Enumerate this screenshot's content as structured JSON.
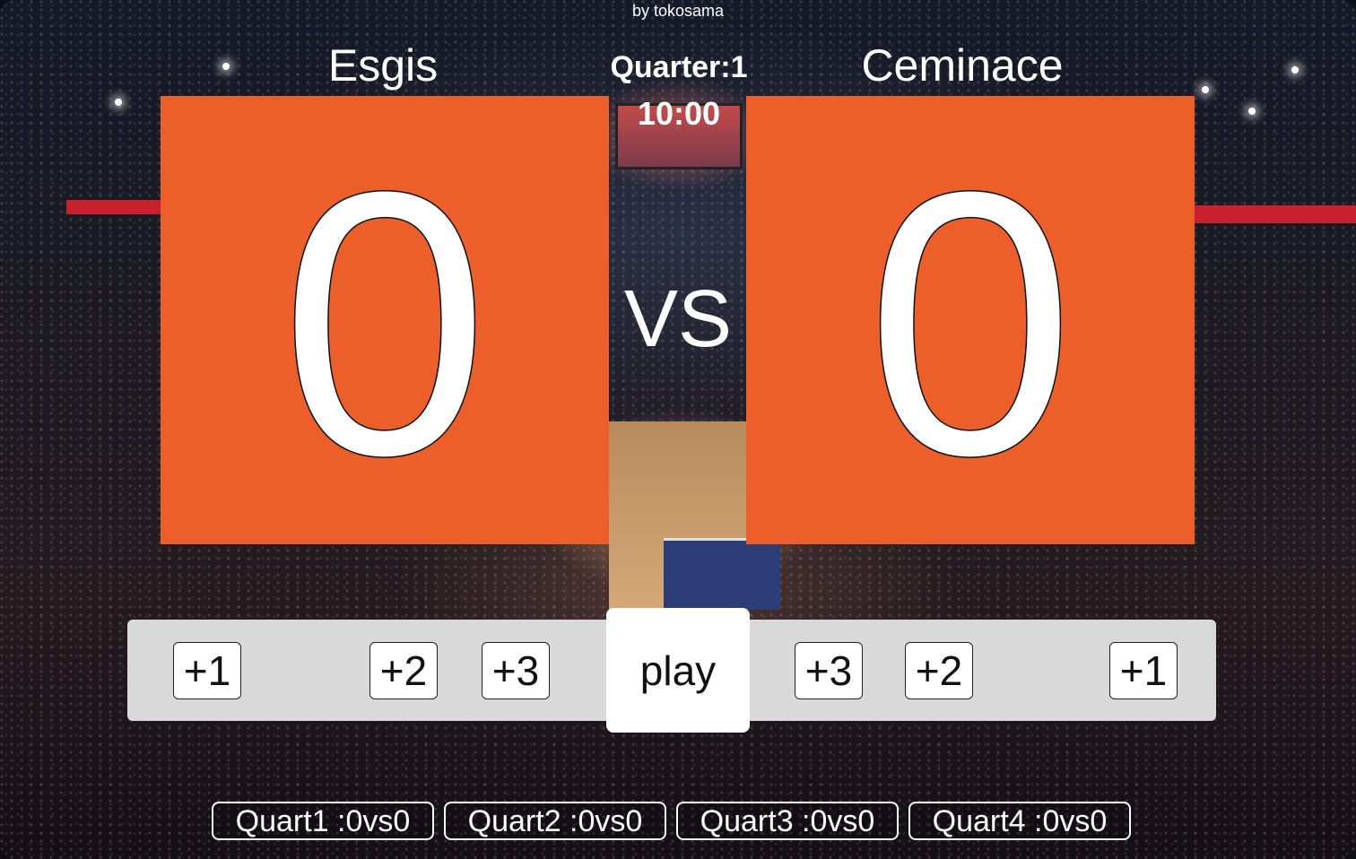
{
  "byline": "by tokosama",
  "teams": {
    "left": {
      "name": "Esgis",
      "score": "0"
    },
    "right": {
      "name": "Ceminace",
      "score": "0"
    }
  },
  "game": {
    "quarter_label": "Quarter:1",
    "clock": "10:00",
    "vs": "VS"
  },
  "controls": {
    "left_buttons": [
      "+1",
      "+2",
      "+3"
    ],
    "play": "play",
    "right_buttons": [
      "+3",
      "+2",
      "+1"
    ]
  },
  "quarters": [
    "Quart1 :0vs0",
    "Quart2 :0vs0",
    "Quart3 :0vs0",
    "Quart4 :0vs0"
  ],
  "colors": {
    "score_bg": "#ec5f2a",
    "control_bar": "#d9d9d9"
  }
}
